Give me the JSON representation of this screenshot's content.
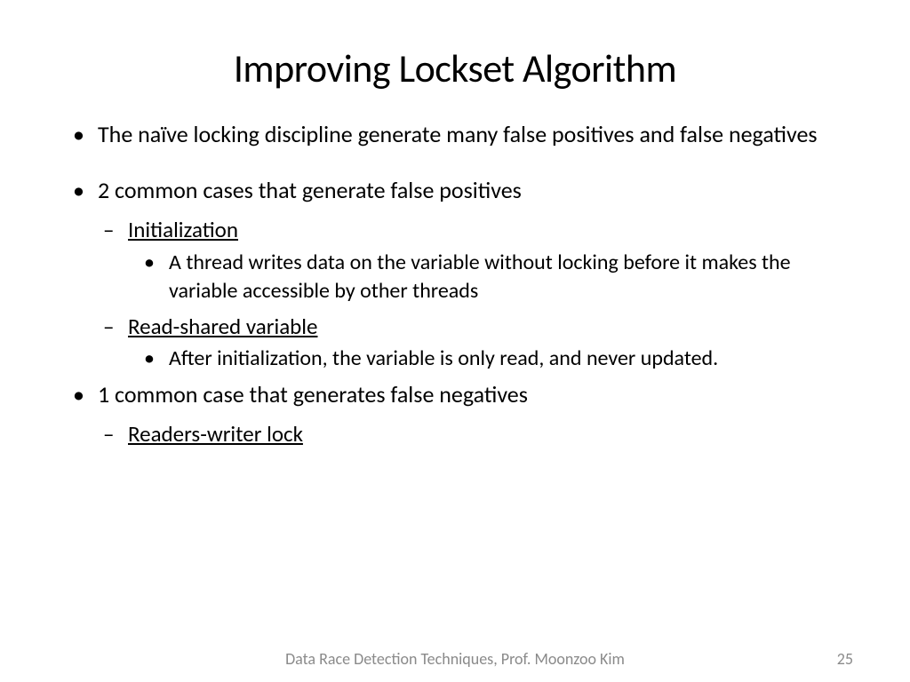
{
  "title": "Improving Lockset Algorithm",
  "bullets": {
    "b1": "The naïve locking discipline generate many false positives and false negatives",
    "b2": "2 common cases that generate false positives",
    "b2a": "Initialization",
    "b2a_detail": "A thread writes data on the variable without locking before it makes the variable accessible by other threads",
    "b2b": "Read-shared variable",
    "b2b_detail": "After initialization, the variable is only read, and never updated.",
    "b3": "1 common case that generates false negatives",
    "b3a": " Readers-writer lock"
  },
  "footer": {
    "text": "Data Race Detection Techniques, Prof. Moonzoo Kim",
    "page": "25"
  }
}
